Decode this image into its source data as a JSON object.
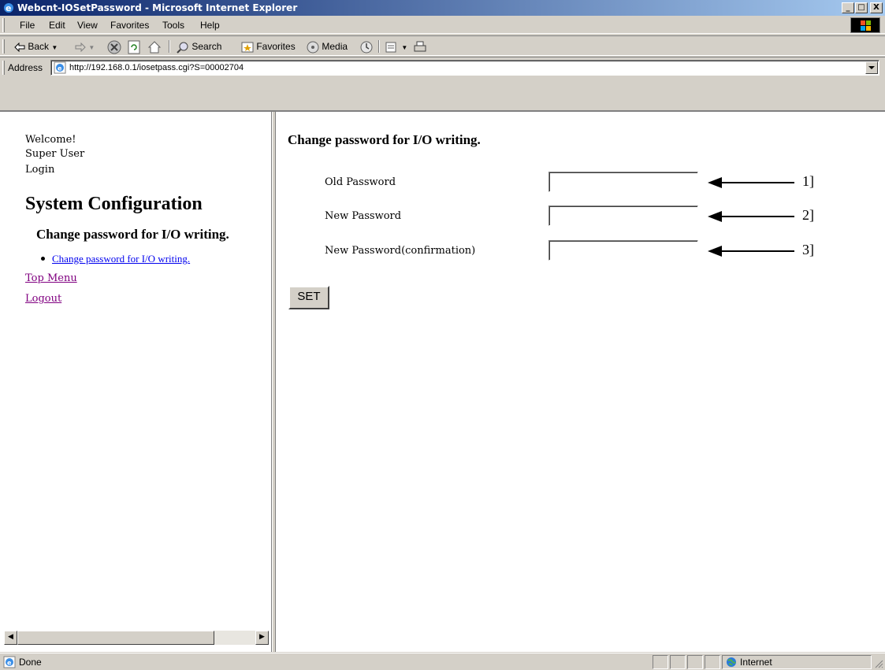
{
  "window": {
    "title": "Webcnt-IOSetPassword - Microsoft Internet Explorer",
    "controls": [
      "_",
      "□",
      "X"
    ]
  },
  "menu": {
    "items": [
      "File",
      "Edit",
      "View",
      "Favorites",
      "Tools",
      "Help"
    ]
  },
  "toolbar": {
    "back_label": "Back",
    "search_label": "Search",
    "favorites_label": "Favorites",
    "media_label": "Media"
  },
  "address": {
    "label": "Address",
    "url": "http://192.168.0.1/iosetpass.cgi?S=00002704"
  },
  "sidebar": {
    "welcome": "Welcome!",
    "user": "Super User",
    "login": "Login",
    "heading": "System Configuration",
    "subheading": "Change password for I/O writing.",
    "bullet_link": "Change password for I/O writing.",
    "top_menu": "Top Menu",
    "logout": "Logout"
  },
  "form": {
    "title": "Change password for I/O writing.",
    "fields": [
      {
        "label": "Old Password",
        "value": "",
        "callout": "1]"
      },
      {
        "label": "New Password",
        "value": "",
        "callout": "2]"
      },
      {
        "label": "New Password(confirmation)",
        "value": "",
        "callout": "3]"
      }
    ],
    "submit_label": "SET"
  },
  "status": {
    "text": "Done",
    "zone": "Internet"
  }
}
